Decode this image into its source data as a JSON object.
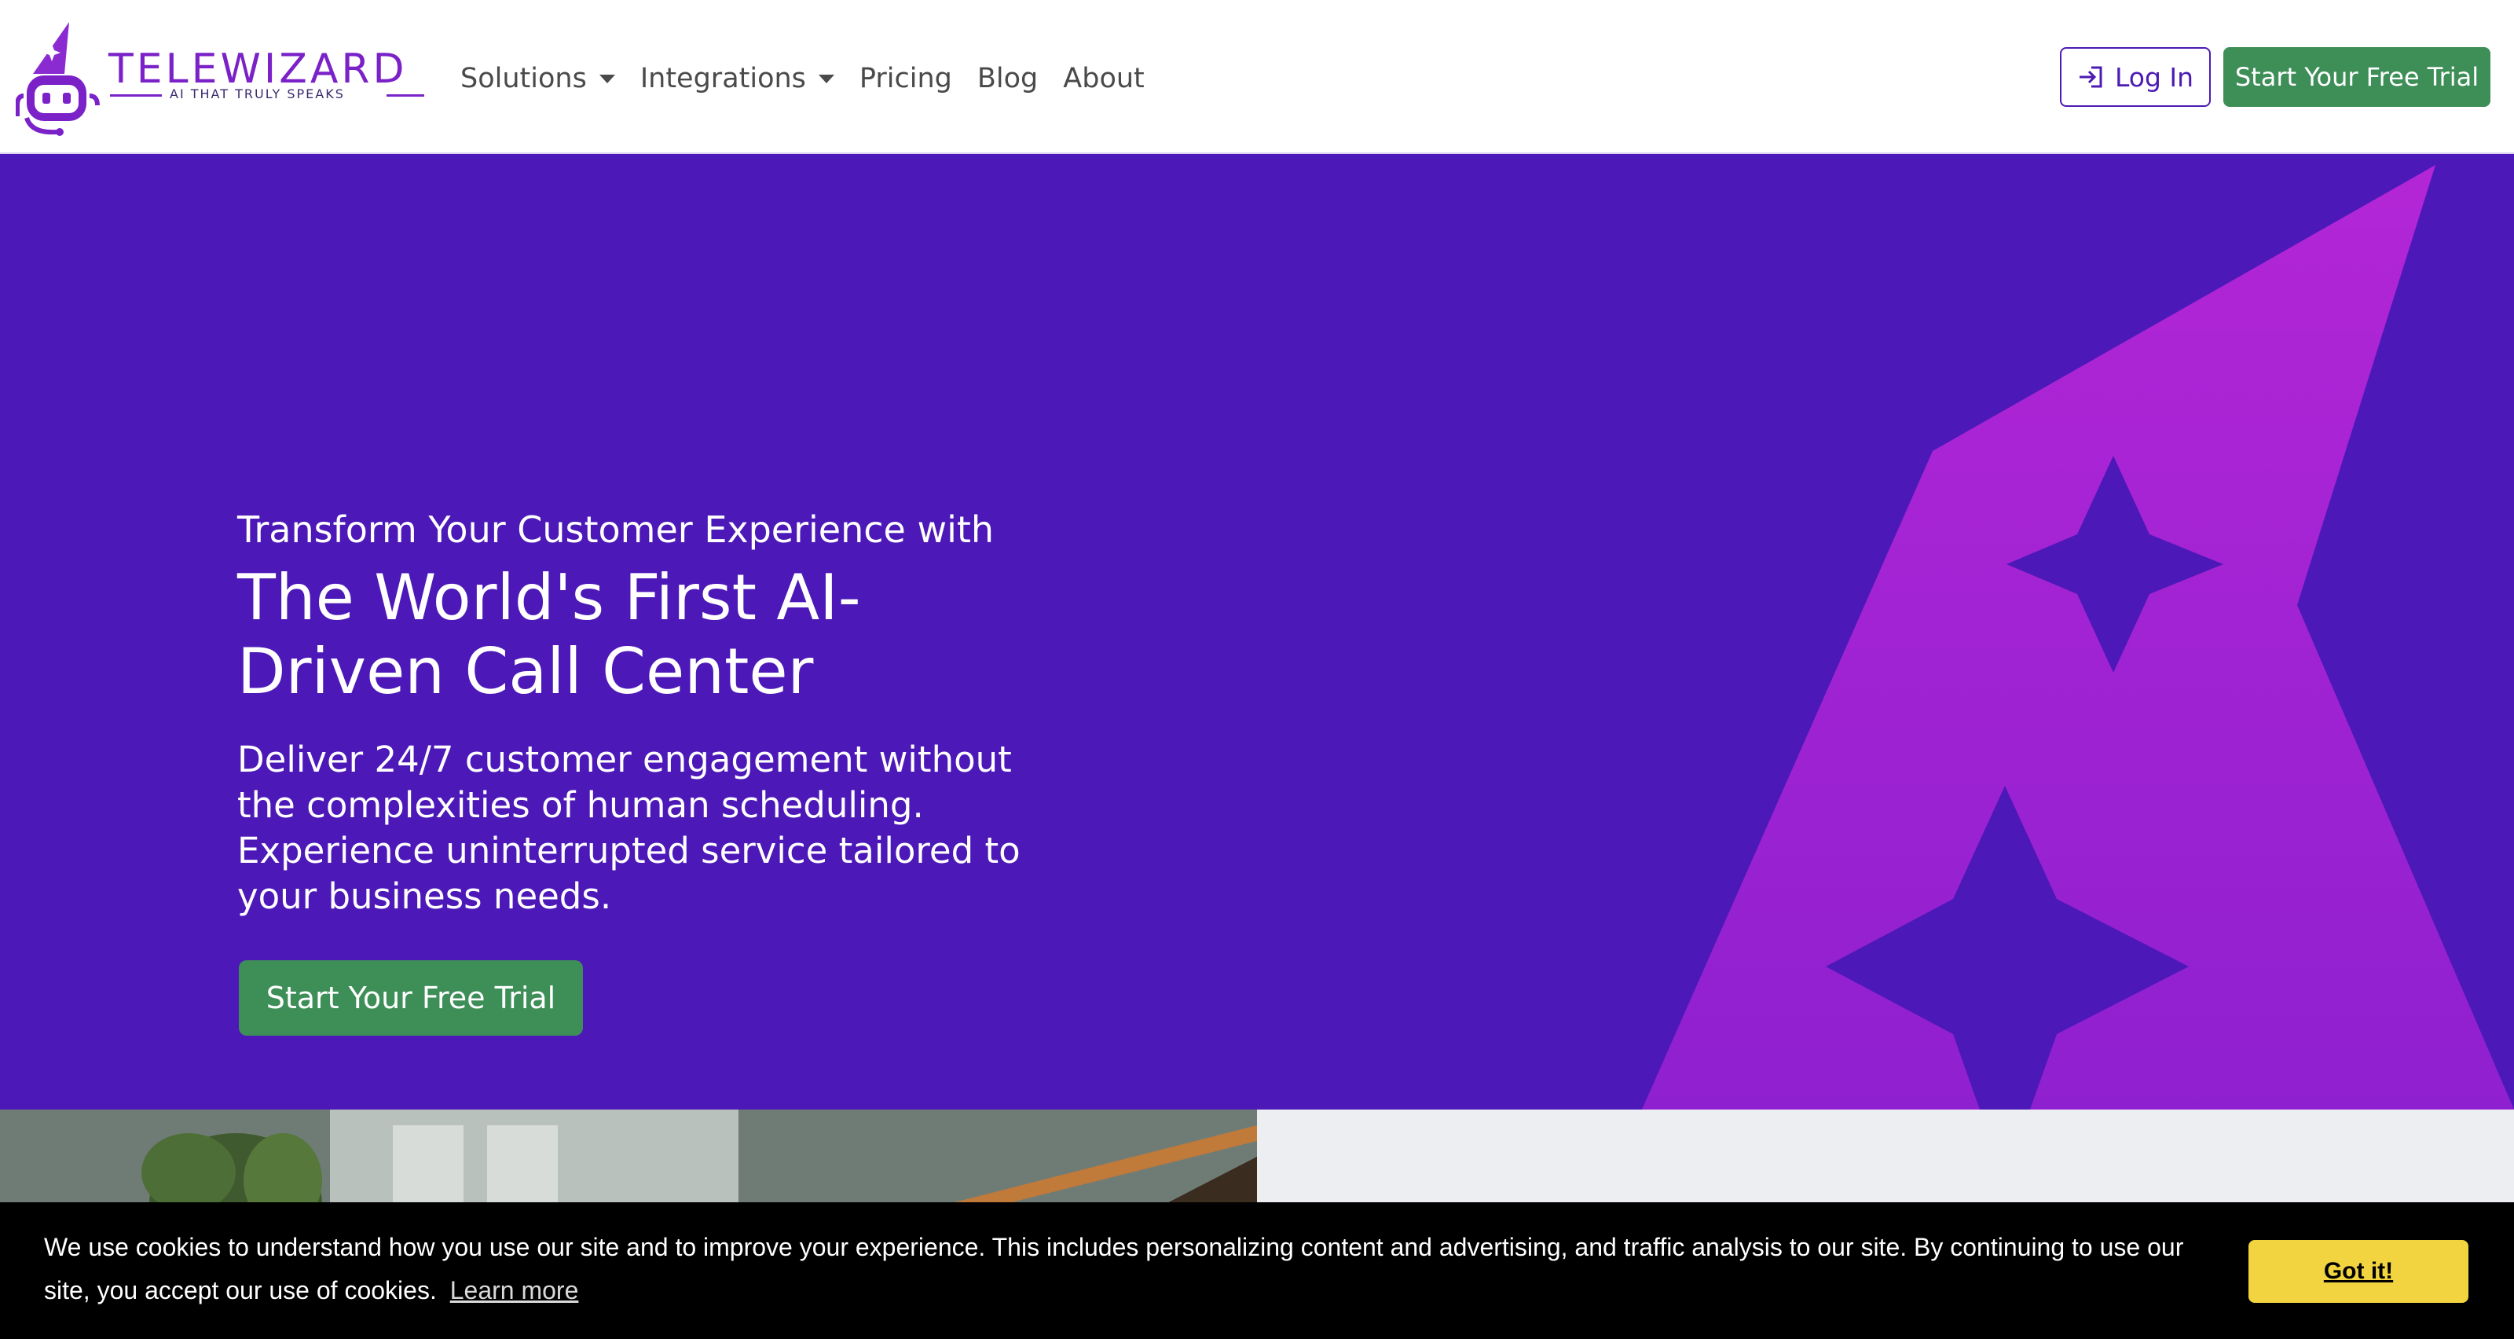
{
  "brand": {
    "name": "TELEWIZARD",
    "tagline": "AI THAT TRULY SPEAKS",
    "accent": "#7a22c8"
  },
  "nav": {
    "items": [
      {
        "label": "Solutions",
        "dropdown": true
      },
      {
        "label": "Integrations",
        "dropdown": true
      },
      {
        "label": "Pricing",
        "dropdown": false
      },
      {
        "label": "Blog",
        "dropdown": false
      },
      {
        "label": "About",
        "dropdown": false
      }
    ],
    "login_label": "Log In",
    "trial_label": "Start Your Free Trial"
  },
  "hero": {
    "pretitle": "Transform Your Customer Experience with",
    "title": "The World's First AI-Driven Call Center",
    "description": "Deliver 24/7 customer engagement without the complexities of human scheduling. Experience uninterrupted service tailored to your business needs.",
    "cta_label": "Start Your Free Trial",
    "background": "#4d18b8",
    "art_color": "#a925d4"
  },
  "cookie_banner": {
    "message": "We use cookies to understand how you use our site and to improve your experience. This includes personalizing content and advertising, and traffic analysis to our site. By continuing to use our site, you accept our use of cookies.",
    "learn_more": "Learn more",
    "accept_label": "Got it!"
  },
  "colors": {
    "primary_green": "#3e8e58",
    "login_border": "#4c1bb3",
    "cookie_button": "#f1d440"
  }
}
